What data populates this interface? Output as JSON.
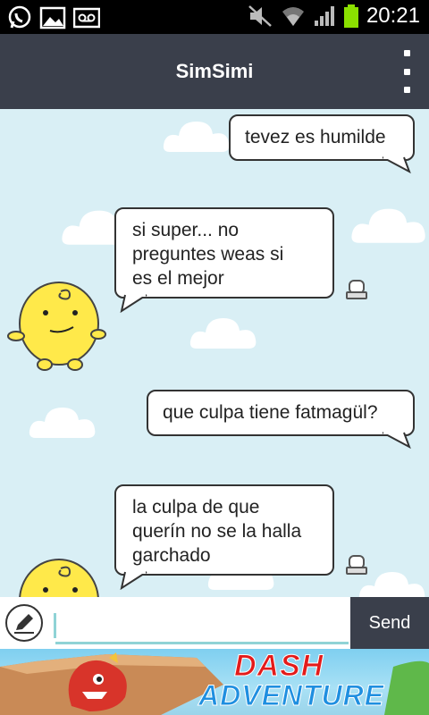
{
  "status_bar": {
    "time": "20:21",
    "icons": [
      "whatsapp-icon",
      "image-icon",
      "voicemail-icon",
      "mute-icon",
      "wifi-icon",
      "signal-icon",
      "battery-icon"
    ]
  },
  "header": {
    "title": "SimSimi",
    "menu_icon": "overflow-menu-icon"
  },
  "messages": [
    {
      "sender": "user",
      "text": "tevez es humilde"
    },
    {
      "sender": "simsimi",
      "text": "si super... no\npreguntes weas si\nes el mejor"
    },
    {
      "sender": "user",
      "text": "que culpa tiene fatmagül?"
    },
    {
      "sender": "simsimi",
      "text": "la culpa de que\nquerín no se la halla\ngarchado"
    }
  ],
  "input": {
    "value": "",
    "placeholder": "",
    "send_label": "Send"
  },
  "ad": {
    "line1": "DASH",
    "line2": "ADVENTURE"
  },
  "colors": {
    "header_bg": "#3a3f4b",
    "chat_bg": "#d9eff5",
    "input_accent": "#8fd3d6",
    "simsimi_yellow": "#ffe94a"
  }
}
